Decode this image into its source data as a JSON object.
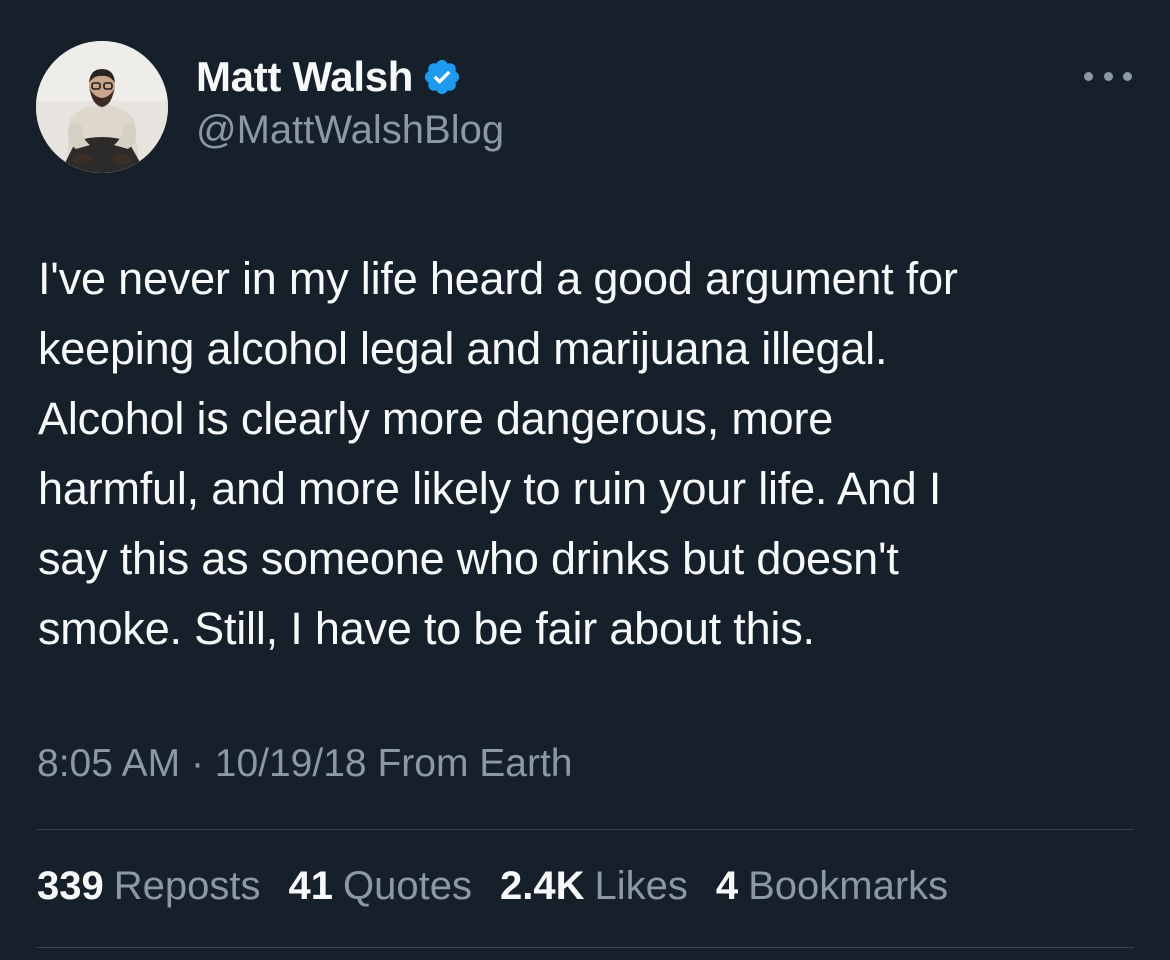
{
  "user": {
    "display_name": "Matt Walsh",
    "handle": "@MattWalshBlog",
    "verified": true,
    "verified_color": "#1d9bf0"
  },
  "tweet": {
    "text": "I've never in my life heard a good argument for\nkeeping alcohol legal and marijuana illegal.\nAlcohol is clearly more dangerous, more\nharmful, and more likely to ruin your life. And I\nsay this as someone who drinks but doesn't\nsmoke. Still, I have to be fair about this.",
    "time": "8:05 AM",
    "separator": "·",
    "date": "10/19/18",
    "source": "From Earth"
  },
  "stats": [
    {
      "count": "339",
      "label": "Reposts"
    },
    {
      "count": "41",
      "label": "Quotes"
    },
    {
      "count": "2.4K",
      "label": "Likes"
    },
    {
      "count": "4",
      "label": "Bookmarks"
    }
  ],
  "icons": {
    "more": "more-horizontal-icon",
    "verified": "verified-badge-icon"
  },
  "colors": {
    "background": "#15202b",
    "primary_text": "#f7f9f9",
    "secondary_text": "#8b98a5",
    "divider": "#38444d"
  }
}
